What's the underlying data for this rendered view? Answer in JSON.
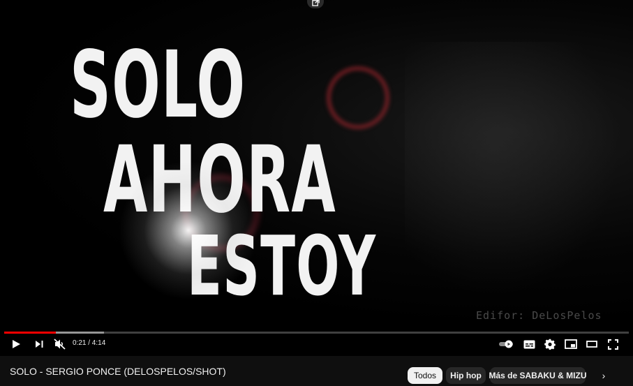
{
  "video": {
    "overlay_words": [
      "SOLO",
      "AHORA",
      "ESTOY"
    ],
    "watermark": "Edifor: DeLosPelos"
  },
  "player": {
    "time_display": "0:21 / 4:14",
    "progress_played": 0.083,
    "progress_buffered": 0.16,
    "icons": {
      "popout": "popout-icon",
      "play": "play-icon",
      "next": "next-icon",
      "mute": "muted-volume-icon",
      "autoplay": "autoplay-toggle-icon",
      "subtitles": "subtitles-icon",
      "settings": "gear-icon",
      "miniplayer": "miniplayer-icon",
      "theater": "theater-mode-icon",
      "fullscreen": "fullscreen-icon"
    },
    "accent_color": "#ff0000"
  },
  "below": {
    "title": "SOLO - SERGIO PONCE (DELOSPELOS/SHOT)",
    "chips": [
      "Todos",
      "Hip hop",
      "Más de SABAKU & MIZU"
    ],
    "chips_next": "›"
  }
}
